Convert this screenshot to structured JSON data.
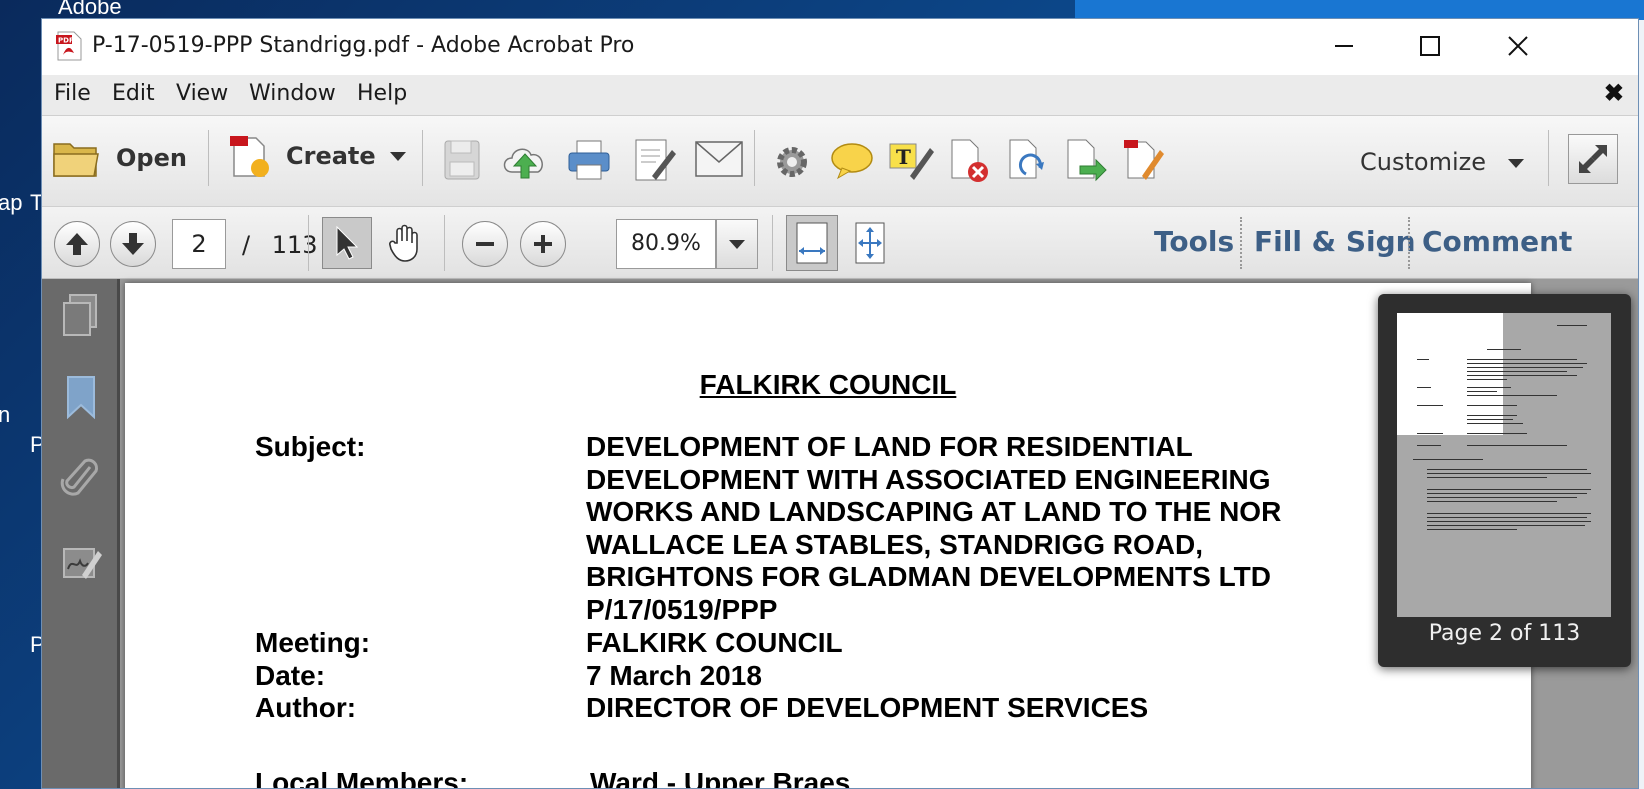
{
  "desktop": {
    "labels": [
      "Adobe",
      "ap",
      "T",
      "n",
      "P",
      "P"
    ]
  },
  "window": {
    "title": "P-17-0519-PPP Standrigg.pdf - Adobe Acrobat Pro",
    "controls": {
      "minimize": "—",
      "maximize": "☐",
      "close": "✕"
    }
  },
  "menu": {
    "items": [
      "File",
      "Edit",
      "View",
      "Window",
      "Help"
    ],
    "close": "✖"
  },
  "toolbar": {
    "open_label": "Open",
    "create_label": "Create",
    "customize_label": "Customize"
  },
  "nav": {
    "current_page": "2",
    "page_separator": "/",
    "total_pages": "113",
    "zoom": "80.9%",
    "tools_label": "Tools",
    "fill_sign_label": "Fill & Sign",
    "comment_label": "Comment"
  },
  "document": {
    "heading": "FALKIRK COUNCIL",
    "subject_label": "Subject:",
    "subject_lines": [
      "DEVELOPMENT OF LAND FOR RESIDENTIAL",
      "DEVELOPMENT WITH ASSOCIATED ENGINEERING",
      "WORKS AND LANDSCAPING AT LAND TO THE NOR",
      "WALLACE LEA STABLES, STANDRIGG ROAD,",
      "BRIGHTONS FOR GLADMAN DEVELOPMENTS LTD",
      "P/17/0519/PPP"
    ],
    "meeting_label": "Meeting:",
    "meeting_value": "FALKIRK COUNCIL",
    "date_label": "Date:",
    "date_value": "7 March 2018",
    "author_label": "Author:",
    "author_value": "DIRECTOR OF DEVELOPMENT SERVICES",
    "members_label": "Local Members:",
    "members_value": "Ward - Upper Braes"
  },
  "thumbnail": {
    "caption": "Page 2 of 113"
  },
  "colors": {
    "link_blue": "#3d5f86",
    "nav_pane": "#6a6a6a",
    "doc_background": "#9a9a9a"
  }
}
